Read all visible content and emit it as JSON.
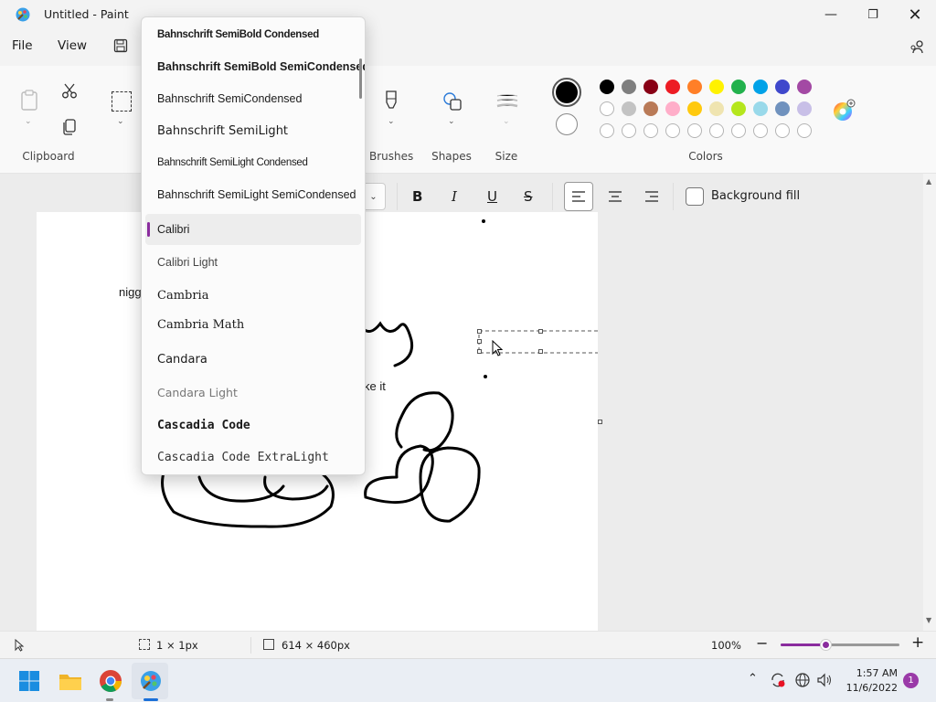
{
  "app": {
    "title": "Untitled - Paint"
  },
  "menu": {
    "file": "File",
    "view": "View"
  },
  "ribbon": {
    "groups": {
      "clipboard": "Clipboard",
      "brushes": "Brushes",
      "shapes": "Shapes",
      "size": "Size",
      "colors": "Colors"
    },
    "colors": {
      "primary": "#000000",
      "secondary": "#ffffff",
      "palette_row1": [
        "#000000",
        "#7f7f7f",
        "#880015",
        "#ed1c24",
        "#ff7f27",
        "#fff200",
        "#22b14c",
        "#00a2e8",
        "#3f48cc",
        "#a349a4"
      ],
      "palette_row2": [
        "#ffffff",
        "#c3c3c3",
        "#b97a57",
        "#ffaec9",
        "#ffc90e",
        "#efe4b0",
        "#b5e61d",
        "#99d9ea",
        "#7092be",
        "#c8bfe7"
      ]
    }
  },
  "text_toolbar": {
    "bold": "B",
    "italic": "I",
    "underline": "U",
    "strike": "S",
    "background_fill": "Background fill"
  },
  "font_dropdown": {
    "selected": "Calibri",
    "items": [
      "Bahnschrift SemiBold Condensed",
      "Bahnschrift SemiBold SemiCondensed",
      "Bahnschrift SemiCondensed",
      "Bahnschrift SemiLight",
      "Bahnschrift SemiLight Condensed",
      "Bahnschrift SemiLight SemiCondensed",
      "Calibri",
      "Calibri Light",
      "Cambria",
      "Cambria Math",
      "Candara",
      "Candara Light",
      "Cascadia Code",
      "Cascadia Code ExtraLight"
    ]
  },
  "canvas": {
    "text_left": "nigg",
    "text_mid": "ke it"
  },
  "status": {
    "selection_size": "1 × 1px",
    "canvas_size": "614 × 460px",
    "zoom": "100%"
  },
  "taskbar": {
    "time": "1:57 AM",
    "date": "11/6/2022",
    "notification_count": "1"
  }
}
